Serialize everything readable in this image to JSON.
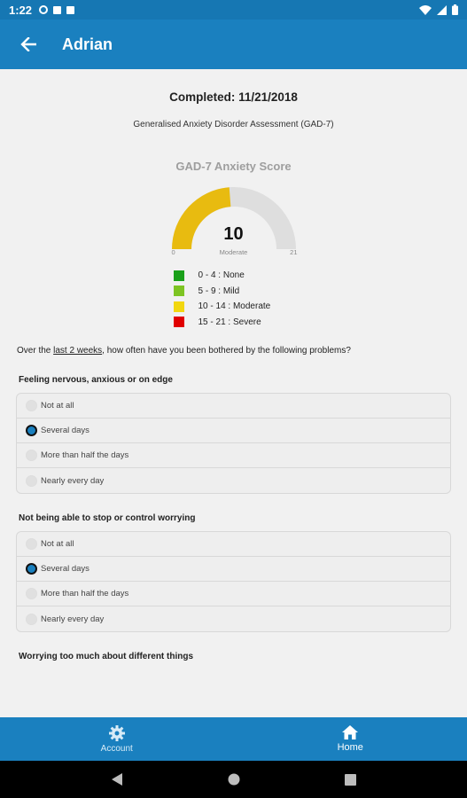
{
  "status_bar": {
    "time": "1:22"
  },
  "app_bar": {
    "title": "Adrian"
  },
  "completed": "Completed: 11/21/2018",
  "assessment_name": "Generalised Anxiety Disorder Assessment (GAD-7)",
  "gauge": {
    "title": "GAD-7 Anxiety Score",
    "value": "10",
    "level": "Moderate",
    "min": "0",
    "max": "21",
    "fill_fraction": 0.476,
    "fill_color": "#e8bb10",
    "track_color": "#dedede"
  },
  "legend": [
    {
      "label": "0 - 4 : None",
      "color": "#1aa01a"
    },
    {
      "label": "5 - 9 : Mild",
      "color": "#7dc423"
    },
    {
      "label": "10 - 14 : Moderate",
      "color": "#f2d70f"
    },
    {
      "label": "15 - 21 : Severe",
      "color": "#e00000"
    }
  ],
  "intro": {
    "before": "Over the ",
    "link": "last 2 weeks",
    "after": ", how often have you been bothered by the following problems?"
  },
  "questions": [
    {
      "title": "Feeling nervous, anxious or on edge",
      "options": [
        "Not at all",
        "Several days",
        "More than half the days",
        "Nearly every day"
      ],
      "selected": "Several days"
    },
    {
      "title": "Not being able to stop or control worrying",
      "options": [
        "Not at all",
        "Several days",
        "More than half the days",
        "Nearly every day"
      ],
      "selected": "Several days"
    },
    {
      "title": "Worrying too much about different things"
    }
  ],
  "bottom_nav": {
    "account": "Account",
    "home": "Home",
    "active": "Home"
  },
  "colors": {
    "primary": "#1a80bf",
    "status_bar": "#1677b3"
  }
}
